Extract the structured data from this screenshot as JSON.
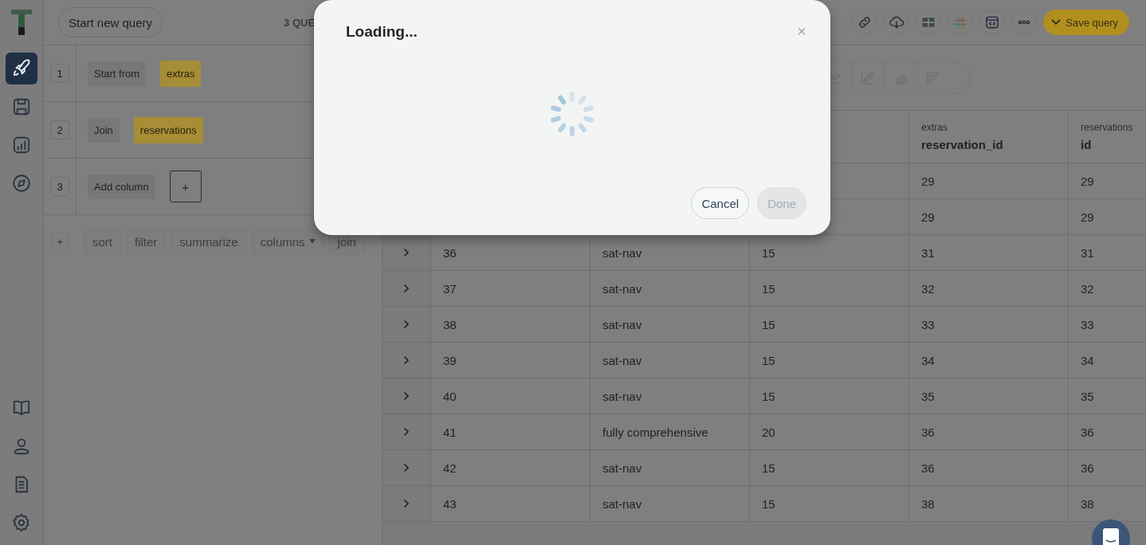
{
  "sidebar": {
    "items": [
      {
        "selected": true
      },
      {
        "selected": false
      },
      {
        "selected": false
      },
      {
        "selected": false
      },
      {
        "selected": false
      },
      {
        "selected": false
      },
      {
        "selected": false
      },
      {
        "selected": false
      }
    ]
  },
  "query_panel": {
    "new_query": "Start new query",
    "steps_count": "3 QUE",
    "steps": [
      {
        "number": "1",
        "kind": "source",
        "label": "Start from",
        "chip": "extras"
      },
      {
        "number": "2",
        "kind": "source",
        "label": "Join",
        "chip": "reservations"
      },
      {
        "number": "3",
        "kind": "action",
        "label": "Add column",
        "action": "+"
      }
    ],
    "add": "+",
    "actions": [
      {
        "label": "sort",
        "dropdown": false
      },
      {
        "label": "filter",
        "dropdown": false
      },
      {
        "label": "summarize",
        "dropdown": false
      },
      {
        "label": "columns",
        "dropdown": true
      },
      {
        "label": "join",
        "dropdown": false
      }
    ]
  },
  "toolbar": {
    "save_button": "Save query"
  },
  "table": {
    "columns": [
      {
        "group": "extras",
        "name": "reservation_id"
      },
      {
        "group": "reservations",
        "name": "id"
      }
    ],
    "rows": [
      {
        "cells": [
          "29",
          "29"
        ]
      },
      {
        "cells": [
          "29",
          "29"
        ]
      },
      {
        "cells": [
          "36",
          "sat-nav",
          "15",
          "31",
          "31"
        ]
      },
      {
        "cells": [
          "37",
          "sat-nav",
          "15",
          "32",
          "32"
        ]
      },
      {
        "cells": [
          "38",
          "sat-nav",
          "15",
          "33",
          "33"
        ]
      },
      {
        "cells": [
          "39",
          "sat-nav",
          "15",
          "34",
          "34"
        ]
      },
      {
        "cells": [
          "40",
          "sat-nav",
          "15",
          "35",
          "35"
        ]
      },
      {
        "cells": [
          "41",
          "fully comprehensive",
          "20",
          "36",
          "36"
        ]
      },
      {
        "cells": [
          "42",
          "sat-nav",
          "15",
          "36",
          "36"
        ]
      },
      {
        "cells": [
          "43",
          "sat-nav",
          "15",
          "38",
          "38"
        ]
      }
    ]
  },
  "modal": {
    "title": "Loading...",
    "close": "×",
    "cancel": "Cancel",
    "done": {
      "label": "Done",
      "disabled": true
    }
  }
}
